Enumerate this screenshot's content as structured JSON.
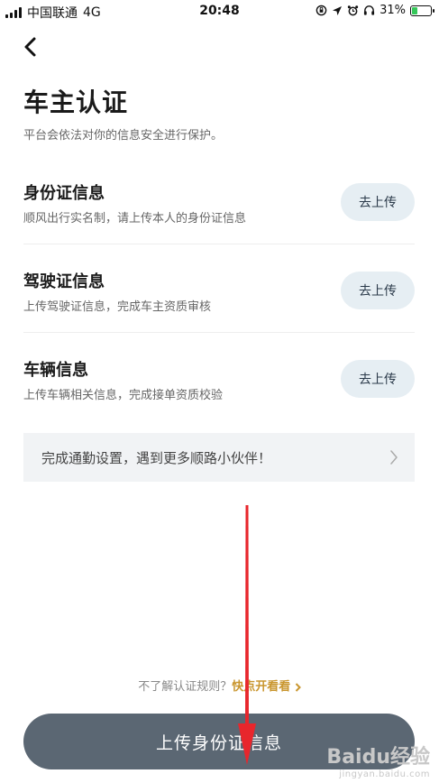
{
  "status_bar": {
    "carrier": "中国联通",
    "network": "4G",
    "time": "20:48",
    "battery_percent": "31%",
    "battery_level": 0.31,
    "battery_color": "#35c759"
  },
  "nav": {
    "back_icon": "chevron-left-icon"
  },
  "header": {
    "title": "车主认证",
    "subtitle": "平台会依法对你的信息安全进行保护。"
  },
  "sections": [
    {
      "title": "身份证信息",
      "desc": "顺风出行实名制，请上传本人的身份证信息",
      "action": "去上传"
    },
    {
      "title": "驾驶证信息",
      "desc": "上传驾驶证信息，完成车主资质审核",
      "action": "去上传"
    },
    {
      "title": "车辆信息",
      "desc": "上传车辆相关信息，完成接单资质校验",
      "action": "去上传"
    }
  ],
  "commute": {
    "text": "完成通勤设置，遇到更多顺路小伙伴！"
  },
  "rules": {
    "question": "不了解认证规则？",
    "link": "快点开看看"
  },
  "primary_button": {
    "label": "上传身份证信息",
    "color": "#5b6773"
  },
  "annotation": {
    "color": "#e8262c"
  },
  "watermark": {
    "brand": "Baidu经验",
    "url": "jingyan.baidu.com"
  }
}
